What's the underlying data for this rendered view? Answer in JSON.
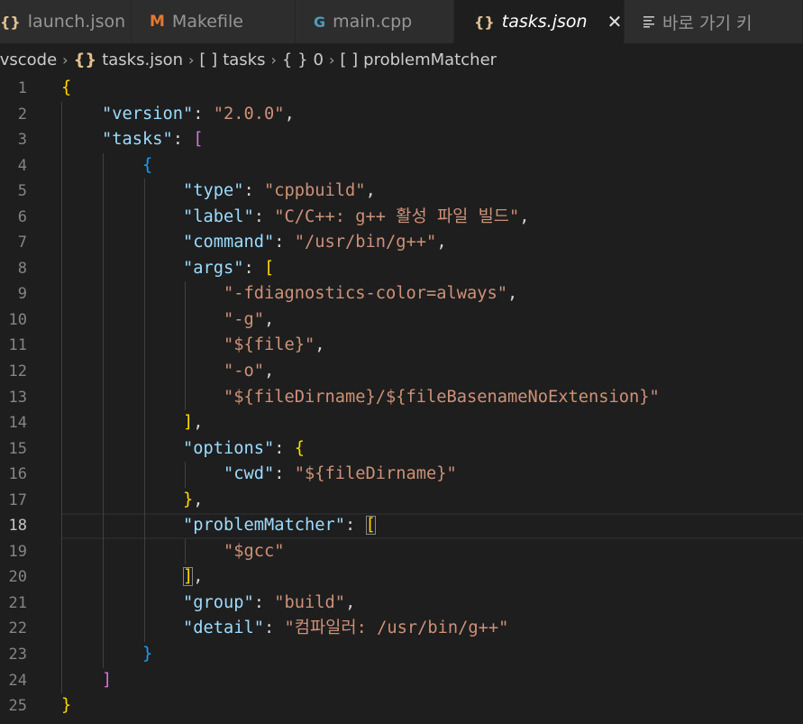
{
  "tabs": [
    {
      "label": "launch.json",
      "icon": "json-braces-icon",
      "active": false
    },
    {
      "label": "Makefile",
      "icon": "makefile-m-icon",
      "active": false
    },
    {
      "label": "main.cpp",
      "icon": "cpp-icon",
      "active": false
    },
    {
      "label": "tasks.json",
      "icon": "json-braces-icon",
      "active": true
    },
    {
      "label": "바로 가기 키",
      "icon": "keyboard-shortcuts-icon",
      "active": false
    }
  ],
  "icons": {
    "json": "{}",
    "makefile": "M",
    "cpp": "G",
    "close": "✕"
  },
  "breadcrumb": [
    ".vscode",
    "tasks.json",
    "tasks",
    "0",
    "problemMatcher"
  ],
  "breadcrumb_symbols": {
    "array": "[ ]",
    "object": "{ }"
  },
  "colors": {
    "key": "#9cdcfe",
    "string": "#ce9178",
    "bracket_gold": "#ffd700",
    "bracket_purple": "#da70d6",
    "bracket_blue": "#179fff",
    "editor_bg": "#1e1e1e",
    "tab_bg": "#2d2d2d"
  },
  "editor": {
    "current_line": 18,
    "lines": [
      "{",
      "    \"version\": \"2.0.0\",",
      "    \"tasks\": [",
      "        {",
      "            \"type\": \"cppbuild\",",
      "            \"label\": \"C/C++: g++ 활성 파일 빌드\",",
      "            \"command\": \"/usr/bin/g++\",",
      "            \"args\": [",
      "                \"-fdiagnostics-color=always\",",
      "                \"-g\",",
      "                \"${file}\",",
      "                \"-o\",",
      "                \"${fileDirname}/${fileBasenameNoExtension}\"",
      "            ],",
      "            \"options\": {",
      "                \"cwd\": \"${fileDirname}\"",
      "            },",
      "            \"problemMatcher\": [",
      "                \"$gcc\"",
      "            ],",
      "            \"group\": \"build\",",
      "            \"detail\": \"컴파일러: /usr/bin/g++\"",
      "        }",
      "    ]",
      "}"
    ]
  }
}
